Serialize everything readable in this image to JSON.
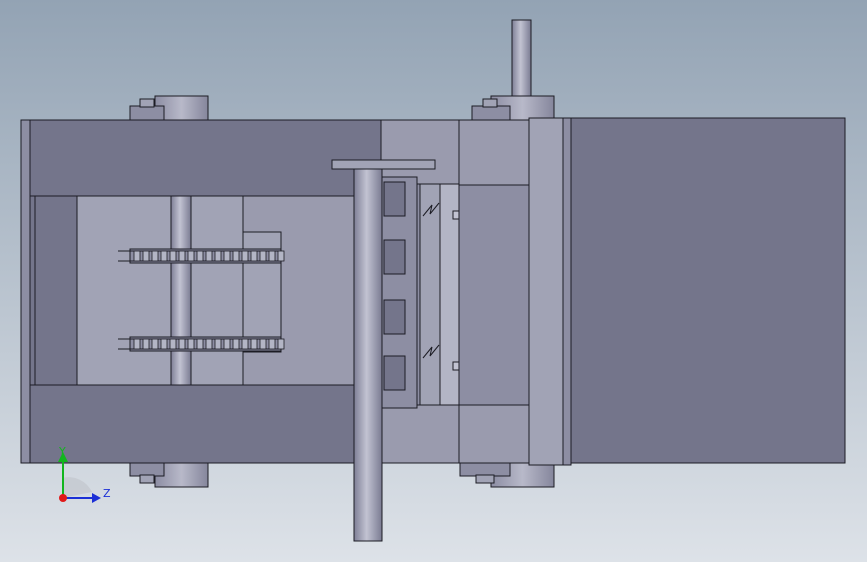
{
  "viewport": {
    "background_top": "#93a3b4",
    "background_bottom": "#dde2e8"
  },
  "colors": {
    "body_main": "#74758b",
    "body_light": "#8d8ea3",
    "panel_light": "#a1a3b5",
    "panel_lighter": "#b3b5c5",
    "outline": "#1c1c24",
    "shaft": "#9c9db3",
    "shaft_highlight": "#c2c3d2",
    "chain": "#6d6e7e",
    "axis_y": "#12b51e",
    "axis_z": "#1b2fd6",
    "axis_origin": "#e01818"
  },
  "triad": {
    "y_label": "Y",
    "z_label": "Z"
  }
}
